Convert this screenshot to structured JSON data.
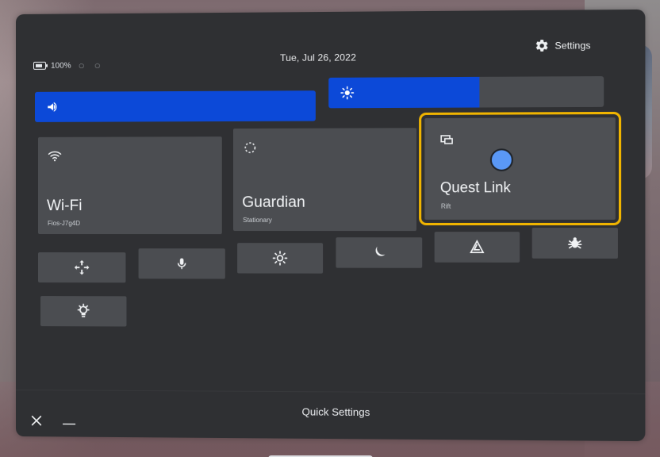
{
  "panel": {
    "status": {
      "battery_percent": "100%"
    },
    "date": "Tue, Jul 26, 2022",
    "settings_label": "Settings"
  },
  "sliders": {
    "volume": {
      "fill_fraction": 1.0
    },
    "brightness": {
      "fill_fraction": 0.55
    }
  },
  "tiles": {
    "wifi": {
      "title": "Wi-Fi",
      "subtitle": "Fios-J7g4D"
    },
    "guardian": {
      "title": "Guardian",
      "subtitle": "Stationary"
    },
    "quest_link": {
      "title": "Quest Link",
      "subtitle": "Rift"
    }
  },
  "small_tiles": [
    {
      "icon": "move-icon"
    },
    {
      "icon": "microphone-icon"
    },
    {
      "icon": "brightness-icon"
    },
    {
      "icon": "moon-icon"
    },
    {
      "icon": "passthrough-icon"
    },
    {
      "icon": "bug-icon"
    },
    {
      "icon": "lightbulb-icon"
    }
  ],
  "bottom_bar": {
    "title": "Quick Settings"
  },
  "colors": {
    "accent": "#0c49d8",
    "highlight": "#f0b400",
    "panel_bg": "#2f3033"
  }
}
